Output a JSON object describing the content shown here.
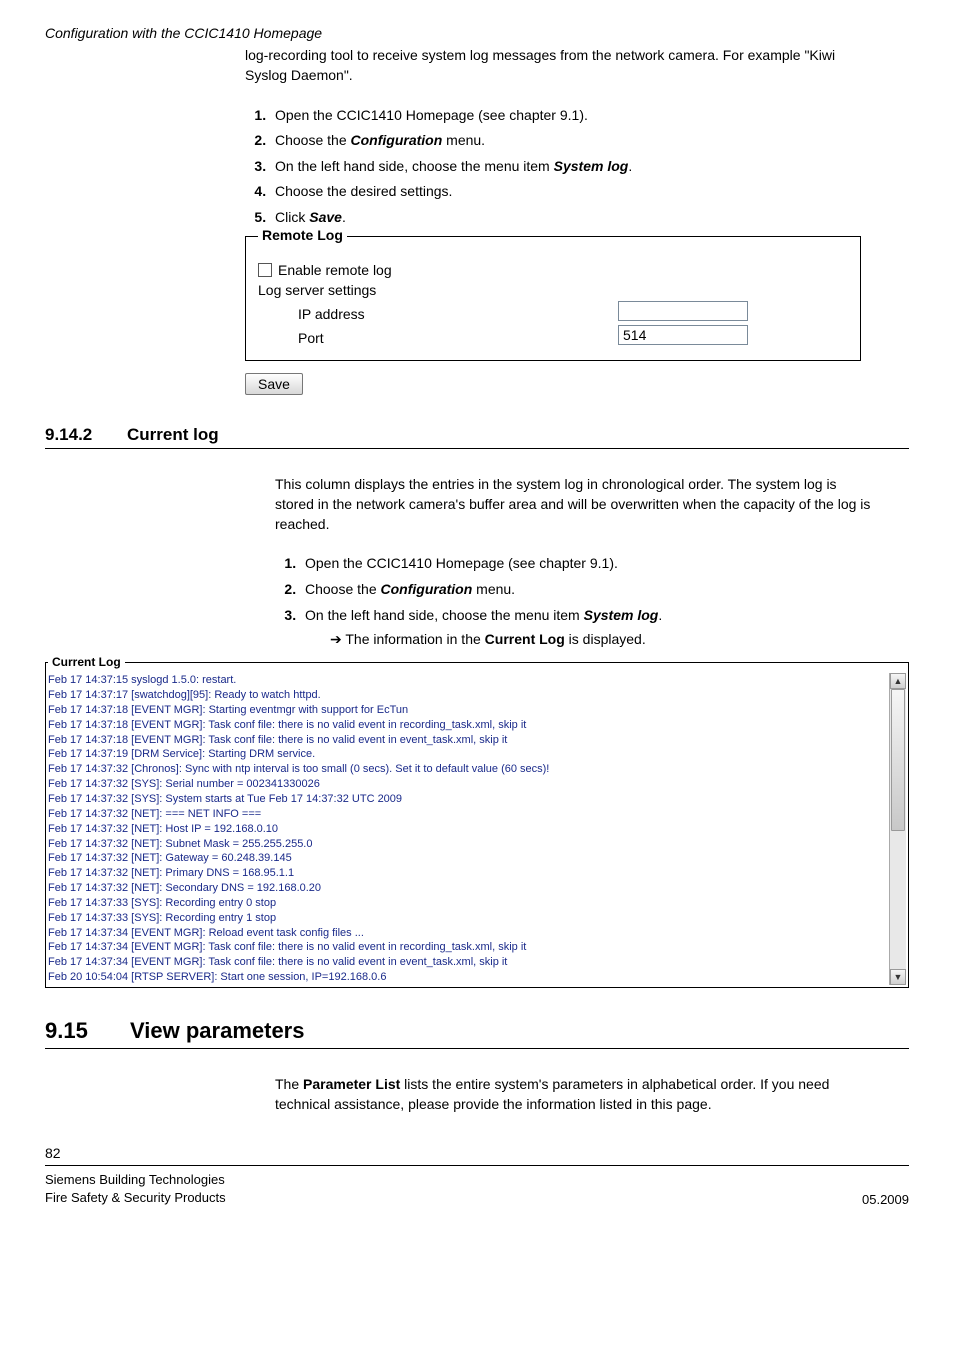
{
  "header": {
    "title": "Configuration with the CCIC1410 Homepage"
  },
  "intro": "log-recording tool to receive system log messages from the network camera. For example \"Kiwi Syslog Daemon\".",
  "steps1": {
    "s1_pre": "Open the CCIC1410 Homepage (see chapter ",
    "s1_ref": "9.1",
    "s1_post": ").",
    "s2_pre": "Choose the ",
    "s2_b": "Configuration",
    "s2_post": " menu.",
    "s3_pre": "On the left hand side, choose the menu item ",
    "s3_b": "System log",
    "s3_post": ".",
    "s4": "Choose the desired settings.",
    "s5_pre": "Click ",
    "s5_b": "Save",
    "s5_post": "."
  },
  "remotelog": {
    "legend": "Remote Log",
    "enable": "Enable remote log",
    "settings": "Log server settings",
    "ip_label": "IP address",
    "port_label": "Port",
    "ip_value": "",
    "port_value": "514",
    "save": "Save"
  },
  "section_currentlog": {
    "num": "9.14.2",
    "title": "Current log"
  },
  "currentlog_intro": "This column displays the entries in the system log in chronological order. The system log is stored in the network camera's buffer area and will be overwritten when the capacity of the log is reached.",
  "steps2": {
    "s1_pre": "Open the CCIC1410 Homepage (see chapter ",
    "s1_ref": "9.1",
    "s1_post": ").",
    "s2_pre": "Choose the ",
    "s2_b": "Configuration",
    "s2_post": " menu.",
    "s3_pre": "On the left hand side, choose the menu item ",
    "s3_b": "System log",
    "s3_post": ".",
    "arrow_pre": "➔ The information in the ",
    "arrow_b": "Current Log",
    "arrow_post": " is displayed."
  },
  "currentlog_panel": {
    "legend": "Current Log",
    "lines": "Feb 17 14:37:15 syslogd 1.5.0: restart.\nFeb 17 14:37:17 [swatchdog][95]: Ready to watch httpd.\nFeb 17 14:37:18 [EVENT MGR]: Starting eventmgr with support for EcTun\nFeb 17 14:37:18 [EVENT MGR]: Task conf file: there is no valid event in recording_task.xml, skip it\nFeb 17 14:37:18 [EVENT MGR]: Task conf file: there is no valid event in event_task.xml, skip it\nFeb 17 14:37:19 [DRM Service]: Starting DRM service.\nFeb 17 14:37:32 [Chronos]: Sync with ntp interval is too small (0 secs). Set it to default value (60 secs)!\nFeb 17 14:37:32 [SYS]: Serial number = 002341330026\nFeb 17 14:37:32 [SYS]: System starts at Tue Feb 17 14:37:32 UTC 2009\nFeb 17 14:37:32 [NET]: === NET INFO ===\nFeb 17 14:37:32 [NET]: Host IP = 192.168.0.10\nFeb 17 14:37:32 [NET]: Subnet Mask = 255.255.255.0\nFeb 17 14:37:32 [NET]: Gateway = 60.248.39.145\nFeb 17 14:37:32 [NET]: Primary DNS = 168.95.1.1\nFeb 17 14:37:32 [NET]: Secondary DNS = 192.168.0.20\nFeb 17 14:37:33 [SYS]: Recording entry 0 stop\nFeb 17 14:37:33 [SYS]: Recording entry 1 stop\nFeb 17 14:37:34 [EVENT MGR]: Reload event task config files ...\nFeb 17 14:37:34 [EVENT MGR]: Task conf file: there is no valid event in recording_task.xml, skip it\nFeb 17 14:37:34 [EVENT MGR]: Task conf file: there is no valid event in event_task.xml, skip it\nFeb 20 10:54:04 [RTSP SERVER]: Start one session, IP=192.168.0.6"
  },
  "section_viewparams": {
    "num": "9.15",
    "title": "View parameters"
  },
  "viewparams_intro_pre": "The ",
  "viewparams_intro_b": "Parameter List",
  "viewparams_intro_post": " lists the entire system's parameters in alphabetical order. If you need technical assistance, please provide the information listed in this page.",
  "footer": {
    "page": "82",
    "company1": "Siemens Building Technologies",
    "company2": "Fire Safety & Security Products",
    "date": "05.2009"
  }
}
